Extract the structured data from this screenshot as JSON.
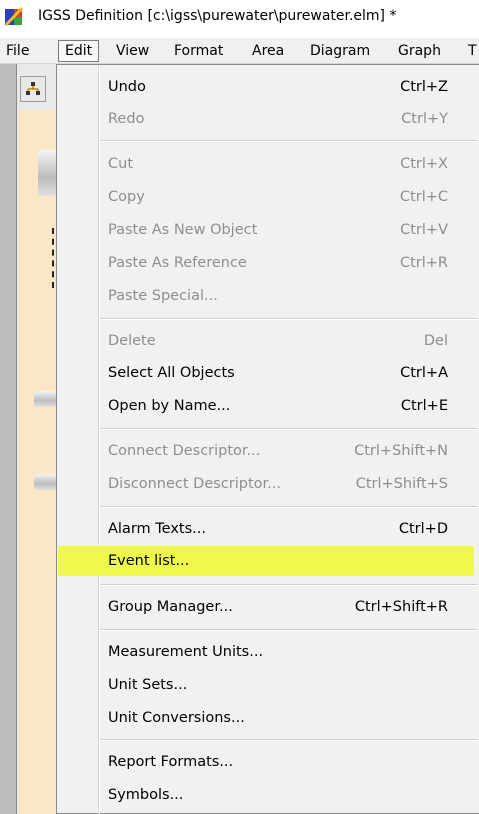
{
  "window": {
    "title": "IGSS Definition [c:\\igss\\purewater\\purewater.elm] *"
  },
  "menubar": {
    "items": [
      "File",
      "Edit",
      "View",
      "Format",
      "Area",
      "Diagram",
      "Graph",
      "T"
    ],
    "active": "Edit"
  },
  "edit_menu": {
    "items": [
      {
        "label": "Undo",
        "shortcut": "Ctrl+Z",
        "enabled": true
      },
      {
        "label": "Redo",
        "shortcut": "Ctrl+Y",
        "enabled": false
      },
      {
        "label": "Cut",
        "shortcut": "Ctrl+X",
        "enabled": false
      },
      {
        "label": "Copy",
        "shortcut": "Ctrl+C",
        "enabled": false
      },
      {
        "label": "Paste As New Object",
        "shortcut": "Ctrl+V",
        "enabled": false
      },
      {
        "label": "Paste As Reference",
        "shortcut": "Ctrl+R",
        "enabled": false
      },
      {
        "label": "Paste Special...",
        "shortcut": "",
        "enabled": false
      },
      {
        "label": "Delete",
        "shortcut": "Del",
        "enabled": false
      },
      {
        "label": "Select All  Objects",
        "shortcut": "Ctrl+A",
        "enabled": true
      },
      {
        "label": "Open by Name...",
        "shortcut": "Ctrl+E",
        "enabled": true
      },
      {
        "label": "Connect Descriptor...",
        "shortcut": "Ctrl+Shift+N",
        "enabled": false
      },
      {
        "label": "Disconnect Descriptor...",
        "shortcut": "Ctrl+Shift+S",
        "enabled": false
      },
      {
        "label": "Alarm Texts...",
        "shortcut": "Ctrl+D",
        "enabled": true
      },
      {
        "label": "Event list...",
        "shortcut": "",
        "enabled": true,
        "highlighted": true
      },
      {
        "label": "Group Manager...",
        "shortcut": "Ctrl+Shift+R",
        "enabled": true
      },
      {
        "label": "Measurement Units...",
        "shortcut": "",
        "enabled": true
      },
      {
        "label": "Unit Sets...",
        "shortcut": "",
        "enabled": true
      },
      {
        "label": "Unit Conversions...",
        "shortcut": "",
        "enabled": true
      },
      {
        "label": "Report Formats...",
        "shortcut": "",
        "enabled": true
      },
      {
        "label": "Symbols...",
        "shortcut": "",
        "enabled": true
      }
    ]
  },
  "colors": {
    "highlight": "#eef94a",
    "disabled_text": "#8e8e8e",
    "menu_bg": "#f1f1f1"
  }
}
